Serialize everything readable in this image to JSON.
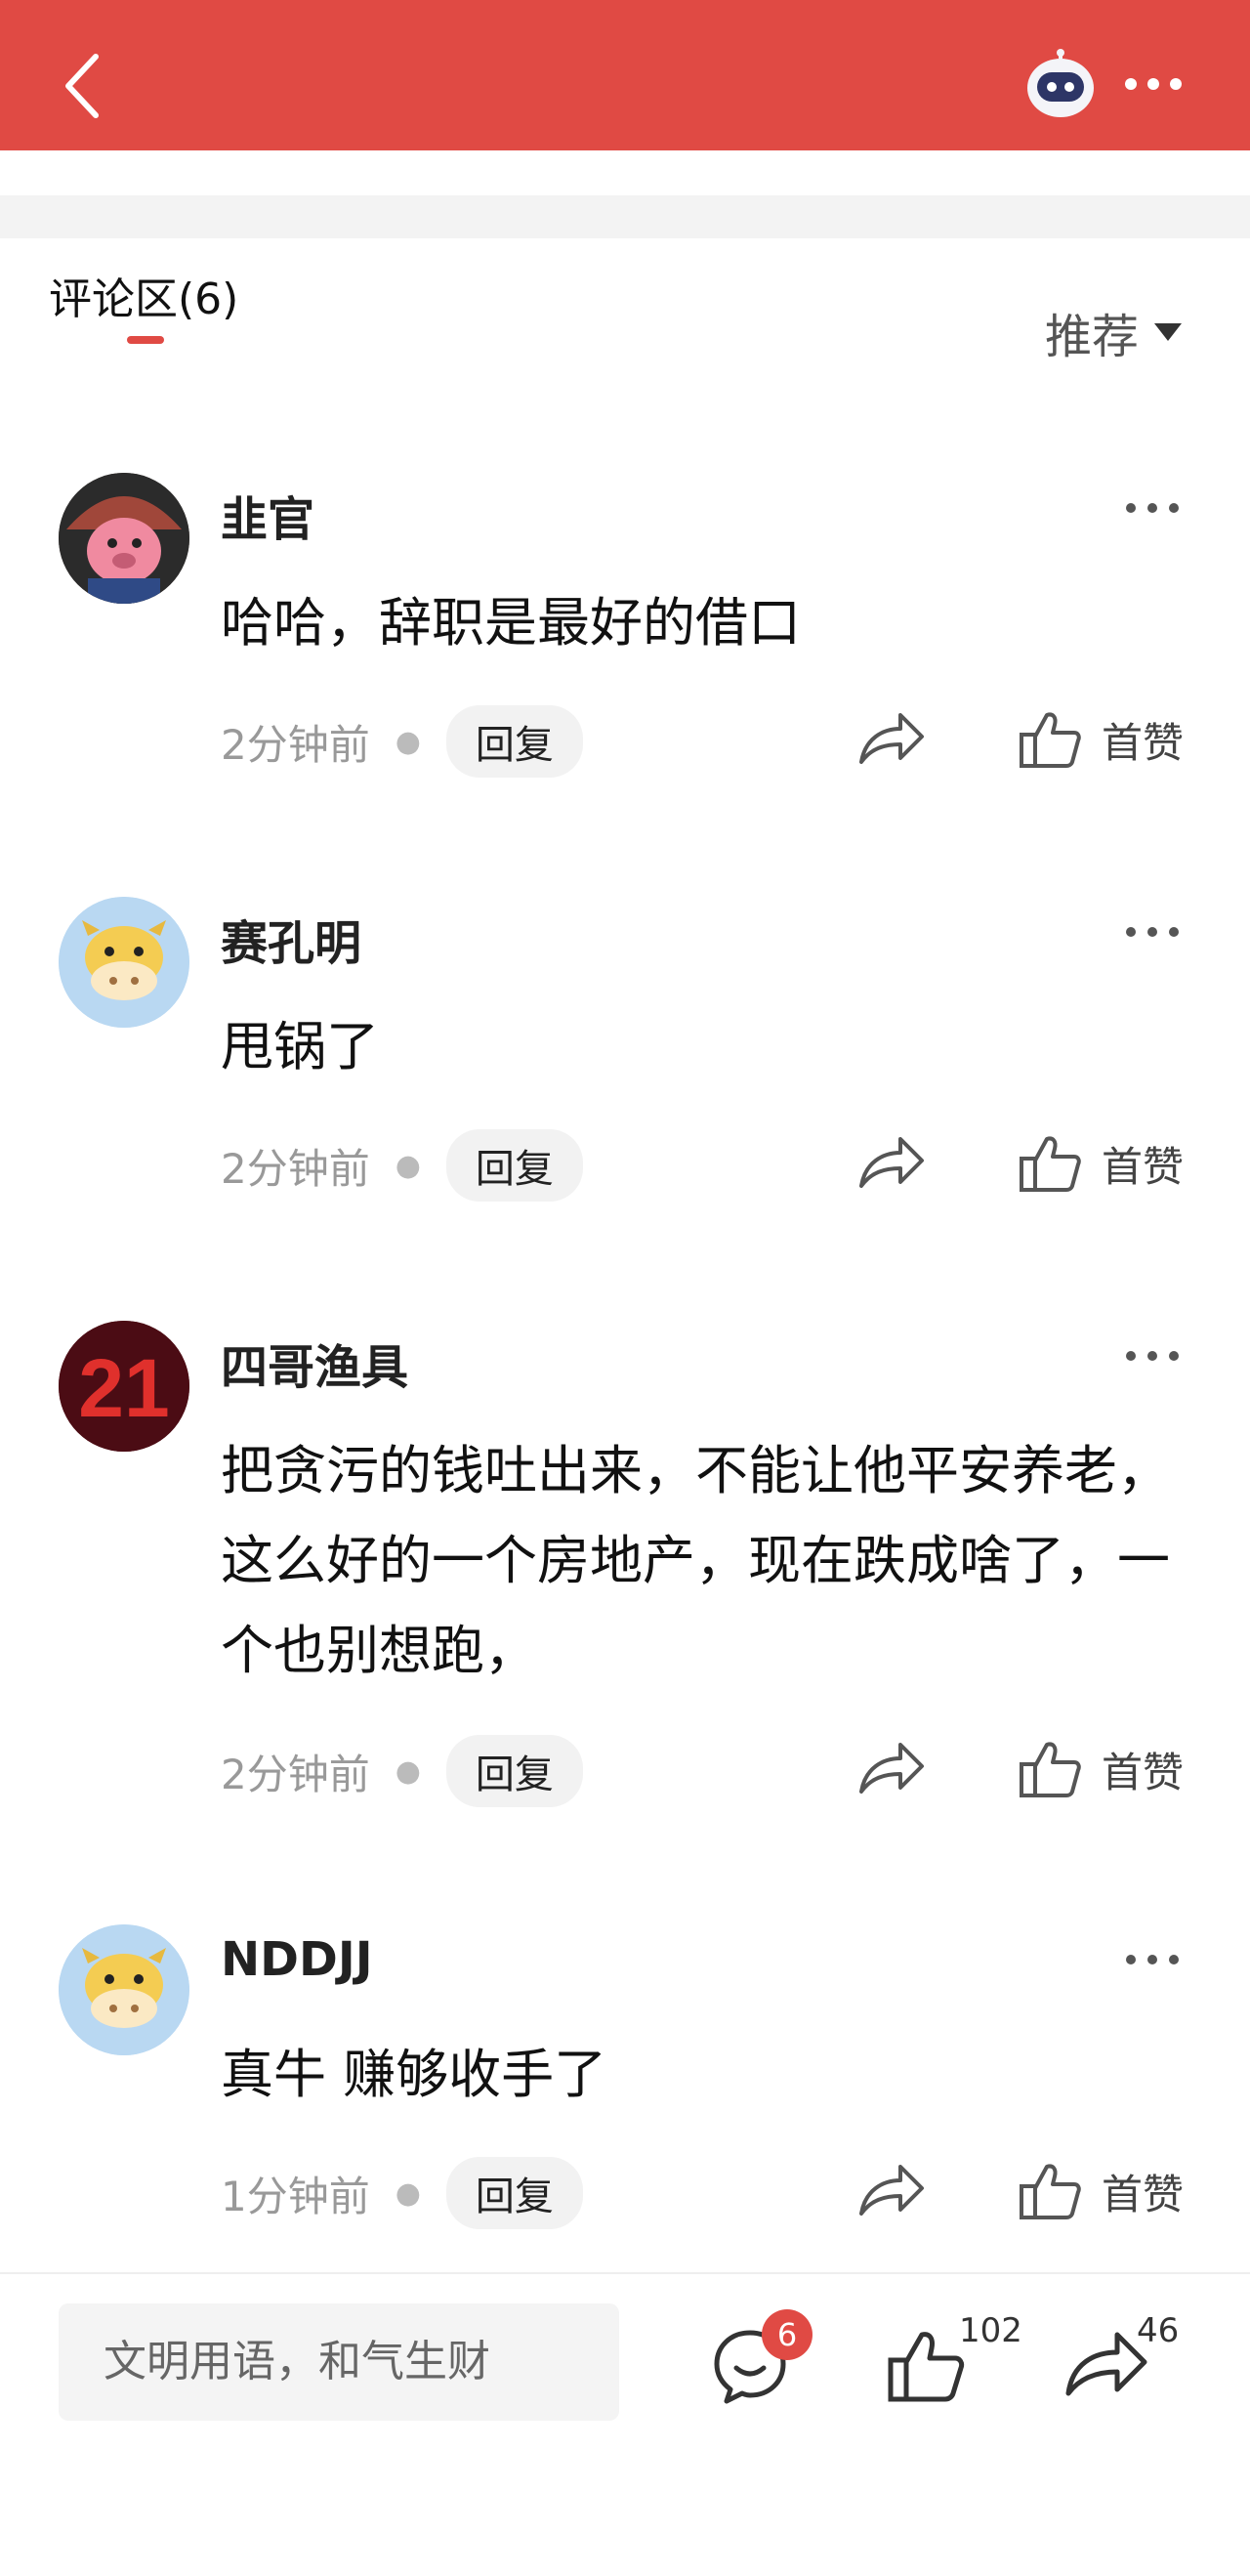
{
  "header": {
    "title": "",
    "icons": [
      "back-icon",
      "robot-assistant-icon",
      "more-icon"
    ]
  },
  "comments_header": {
    "tab_label": "评论区(6)",
    "sort_label": "推荐"
  },
  "comments": [
    {
      "user": "韭官",
      "text": "哈哈，辞职是最好的借口",
      "time": "2分钟前",
      "reply": "回复",
      "like": "首赞"
    },
    {
      "user": "赛孔明",
      "text": "甩锅了",
      "time": "2分钟前",
      "reply": "回复",
      "like": "首赞"
    },
    {
      "user": "四哥渔具",
      "text": "把贪污的钱吐出来，不能让他平安养老，这么好的一个房地产，现在跌成啥了，一个也别想跑，",
      "time": "2分钟前",
      "reply": "回复",
      "like": "首赞"
    },
    {
      "user": "NDDJJ",
      "text": "真牛 赚够收手了",
      "time": "1分钟前",
      "reply": "回复",
      "like": "首赞"
    }
  ],
  "bottom_bar": {
    "input_placeholder": "文明用语，和气生财",
    "comment_count": "6",
    "like_count": "102",
    "share_count": "46"
  },
  "colors": {
    "accent": "#e04a44",
    "avatar_cow_bg": "#b9d8f2"
  }
}
